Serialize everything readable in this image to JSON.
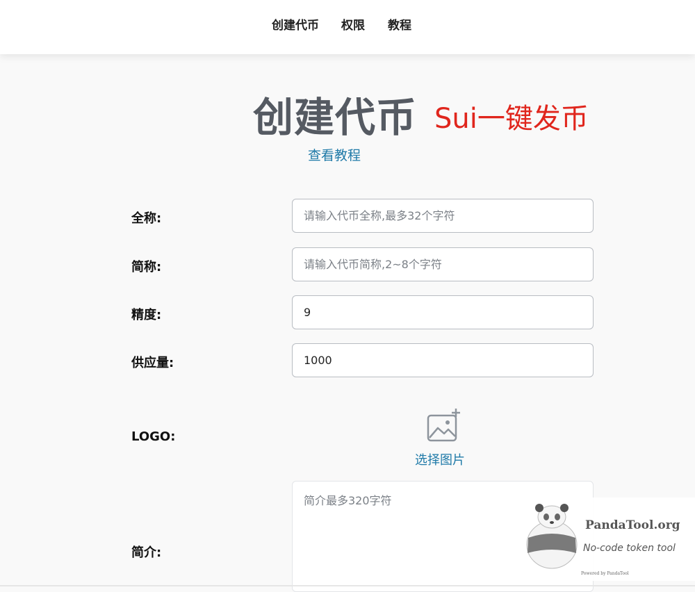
{
  "nav": {
    "items": [
      "创建代币",
      "权限",
      "教程"
    ]
  },
  "header": {
    "title": "创建代币",
    "subtitle": "Sui一键发币",
    "tutorial_link": "查看教程"
  },
  "form": {
    "fullname": {
      "label": "全称:",
      "placeholder": "请输入代币全称,最多32个字符",
      "value": ""
    },
    "symbol": {
      "label": "简称:",
      "placeholder": "请输入代币简称,2~8个字符",
      "value": ""
    },
    "decimals": {
      "label": "精度:",
      "value": "9"
    },
    "supply": {
      "label": "供应量:",
      "value": "1000"
    },
    "logo": {
      "label": "LOGO:",
      "button": "选择图片",
      "icon": "image-add-icon"
    },
    "description": {
      "label": "简介:",
      "placeholder": "简介最多320字符"
    }
  },
  "watermark": {
    "title": "PandaTool.org",
    "subtitle": "No-code token tool",
    "powered": "Powered by PandaTool"
  },
  "colors": {
    "accent": "#1f7aa8",
    "title_gray": "#555a62",
    "subtitle_red": "#e0261d"
  }
}
